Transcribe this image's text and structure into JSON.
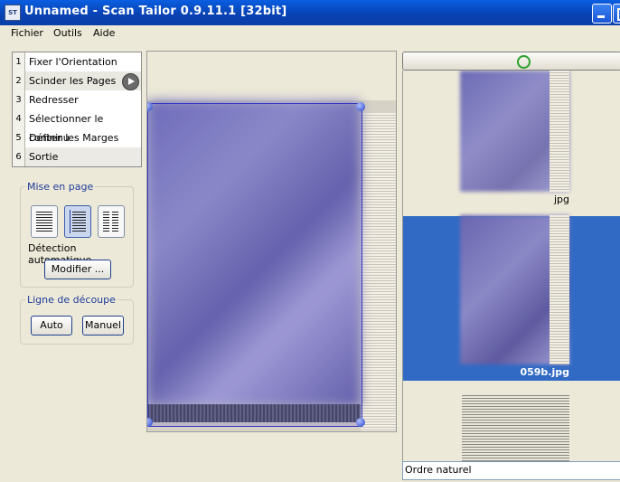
{
  "window": {
    "icon_text": "ST",
    "title": "Unnamed - Scan Tailor 0.9.11.1 [32bit]"
  },
  "menu": [
    "Fichier",
    "Outils",
    "Aide"
  ],
  "steps": [
    {
      "num": "1",
      "label": "Fixer l'Orientation"
    },
    {
      "num": "2",
      "label": "Scinder les Pages"
    },
    {
      "num": "3",
      "label": "Redresser"
    },
    {
      "num": "4",
      "label": "Sélectionner le contenu"
    },
    {
      "num": "5",
      "label": "Définir les Marges"
    },
    {
      "num": "6",
      "label": "Sortie"
    }
  ],
  "layout_group": {
    "title": "Mise en page",
    "detection": "Détection automatique",
    "modify_button": "Modifier ..."
  },
  "split_group": {
    "title": "Ligne de découpe",
    "auto_button": "Auto",
    "manual_button": "Manuel"
  },
  "thumbnails": [
    {
      "label": "jpg"
    },
    {
      "label": "059b.jpg"
    }
  ],
  "sort_field": "Ordre naturel",
  "colors": {
    "title_bar": "#0842b4",
    "selection": "#316ac5",
    "group_title": "#1f3c9a"
  }
}
